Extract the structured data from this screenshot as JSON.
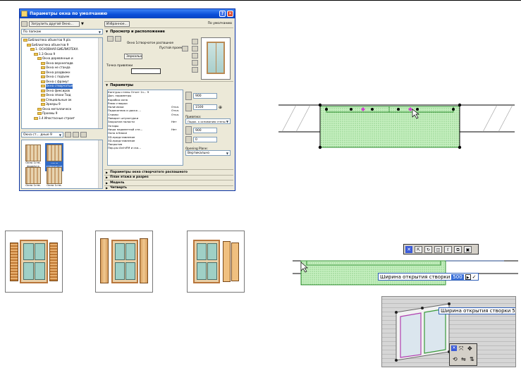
{
  "dialog": {
    "title": "Параметры окна по умолчанию",
    "help_label": "?",
    "close_label": "✕",
    "load_button": "Загрузить другой Окно...",
    "favorites_button": "Избранное...",
    "default_label": "По умолчанию",
    "search_scope": "По папкам",
    "tree": [
      {
        "label": "Библиотека объектов 9.pla",
        "level": 0
      },
      {
        "label": "Библиотека объектов 9",
        "level": 1
      },
      {
        "label": "1. ОСНОВНАЯ БИБЛИОТЕКА",
        "level": 2
      },
      {
        "label": "1.3 Окна 9",
        "level": 3
      },
      {
        "label": "Окна деревянные и",
        "level": 4
      },
      {
        "label": "Окна верхнеподв",
        "level": 5
      },
      {
        "label": "Окна не станда",
        "level": 5
      },
      {
        "label": "Окна раздвижн",
        "level": 5
      },
      {
        "label": "Окна с подъем",
        "level": 5
      },
      {
        "label": "Окна с фрамуг",
        "level": 5
      },
      {
        "label": "Окна створчатые",
        "level": 5,
        "selected": true
      },
      {
        "label": "Окна фиксиров",
        "level": 5
      },
      {
        "label": "Окна эпохи Тюд",
        "level": 5
      },
      {
        "label": "Специальные ок",
        "level": 5
      },
      {
        "label": "Эркеры 9",
        "level": 5
      },
      {
        "label": "Окна металлическ",
        "level": 4
      },
      {
        "label": "Проемы 9",
        "level": 4
      },
      {
        "label": "1.4 Ипостасные строит",
        "level": 3
      }
    ],
    "subfolder_combo": "Окна ст... дные 9",
    "thumbnails": [
      {
        "label": "Окно 1ств. фрамуга внизу",
        "selected": false
      },
      {
        "label": "Окно створчатое рас",
        "selected": true
      },
      {
        "label": "Окно 1ств. горизонталь",
        "selected": false
      },
      {
        "label": "Окно 1ств. фрамуга вверху",
        "selected": false
      }
    ],
    "preview_section": "Просмотр и расположение",
    "opening_label": "Окно 1створчатое распашное",
    "empty_opening": "Пустой проем",
    "mirror_button": "Зеркально",
    "anchor_label": "Точка привязки",
    "params_section": "Параметры",
    "params": [
      {
        "name": "Контуры стены Отчет 1з... 9",
        "value": ""
      },
      {
        "name": "Доп. параметры",
        "value": ""
      },
      {
        "name": "Коробка окна",
        "value": ""
      },
      {
        "name": "Рама створки",
        "value": ""
      },
      {
        "name": "Наличники",
        "value": "Откл."
      },
      {
        "name": "Подоконник и доска ...",
        "value": "Откл."
      },
      {
        "name": "Ставни",
        "value": "Откл."
      },
      {
        "name": "Поворот штукатурки",
        "value": ""
      },
      {
        "name": "Закрытие полости",
        "value": "Нет"
      },
      {
        "name": "Экторы",
        "value": ""
      },
      {
        "name": "Ниша параметной сте...",
        "value": "Нет"
      },
      {
        "name": "Окно в блоке",
        "value": ""
      },
      {
        "name": "2D-представление",
        "value": ""
      },
      {
        "name": "3D-представление",
        "value": ""
      },
      {
        "name": "Покрытия",
        "value": ""
      },
      {
        "name": "Пор-ры ArchiFM и ско...",
        "value": ""
      }
    ],
    "width_value": "900",
    "height_value": "1500",
    "anchor_mode_label": "Привязка:",
    "anchor_mode_value": "Подок. к основанию стены",
    "sill_value": "900",
    "offset_value": "0",
    "opening_plane_label": "Opening Plane:",
    "opening_plane_value": "Вертикально",
    "bottom_sections": [
      "Параметры окна створчатого распашного",
      "План этажа и разрез",
      "Модель",
      "Четверть"
    ]
  },
  "tooltips": {
    "sash_width_label": "Ширина открытия створки",
    "sash_width_value": "500",
    "sash_width_short": "500",
    "confirm_label": "✓",
    "dropdown_label": "▶"
  },
  "colors": {
    "dialog_title_bar": "#0a4ed8",
    "wall_fill": "#c6f0c0",
    "wall_stroke": "#2f8f2f",
    "selection_blue": "#316ac5",
    "shutter_wood": "#c07a35",
    "glass": "#9fd0c6"
  }
}
